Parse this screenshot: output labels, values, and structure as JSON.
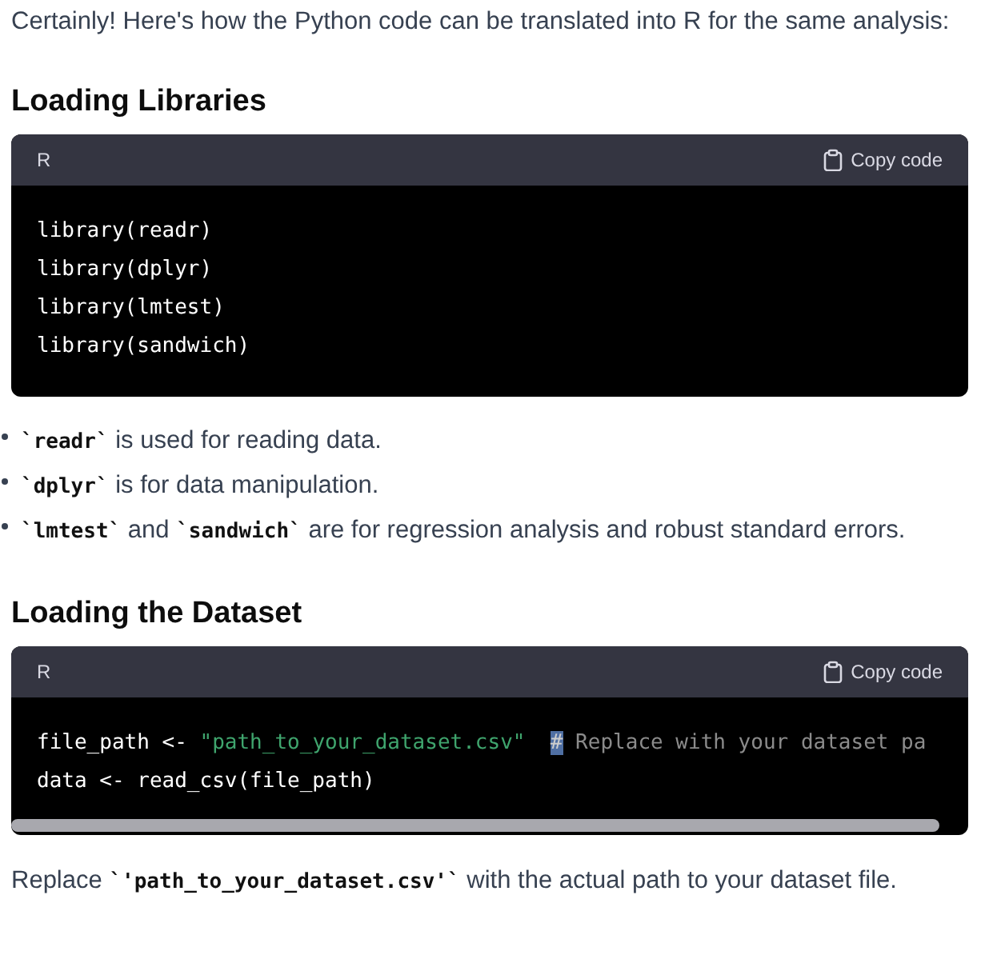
{
  "intro": "Certainly! Here's how the Python code can be translated into R for the same analysis:",
  "sections": [
    {
      "heading": "Loading Libraries",
      "code_block": {
        "language": "R",
        "copy_label": "Copy code",
        "scrollbar": false,
        "lines": [
          [
            {
              "kind": "plain",
              "text": "library(readr)"
            }
          ],
          [
            {
              "kind": "plain",
              "text": "library(dplyr)"
            }
          ],
          [
            {
              "kind": "plain",
              "text": "library(lmtest)"
            }
          ],
          [
            {
              "kind": "plain",
              "text": "library(sandwich)"
            }
          ]
        ]
      },
      "bullets": [
        [
          {
            "kind": "code",
            "text": "`readr`"
          },
          {
            "kind": "text",
            "text": " is used for reading data."
          }
        ],
        [
          {
            "kind": "code",
            "text": "`dplyr`"
          },
          {
            "kind": "text",
            "text": " is for data manipulation."
          }
        ],
        [
          {
            "kind": "code",
            "text": "`lmtest`"
          },
          {
            "kind": "text",
            "text": " and "
          },
          {
            "kind": "code",
            "text": "`sandwich`"
          },
          {
            "kind": "text",
            "text": " are for regression analysis and robust standard errors."
          }
        ]
      ]
    },
    {
      "heading": "Loading the Dataset",
      "code_block": {
        "language": "R",
        "copy_label": "Copy code",
        "scrollbar": true,
        "lines": [
          [
            {
              "kind": "plain",
              "text": "file_path <- "
            },
            {
              "kind": "string",
              "text": "\"path_to_your_dataset.csv\"  "
            },
            {
              "kind": "selected",
              "text": "#"
            },
            {
              "kind": "comment",
              "text": " Replace with your dataset pa"
            }
          ],
          [
            {
              "kind": "plain",
              "text": "data <- read_csv(file_path)"
            }
          ]
        ]
      },
      "paragraph": [
        {
          "kind": "text",
          "text": "Replace "
        },
        {
          "kind": "code",
          "text": "`'path_to_your_dataset.csv'`"
        },
        {
          "kind": "text",
          "text": " with the actual path to your dataset file."
        }
      ]
    }
  ]
}
